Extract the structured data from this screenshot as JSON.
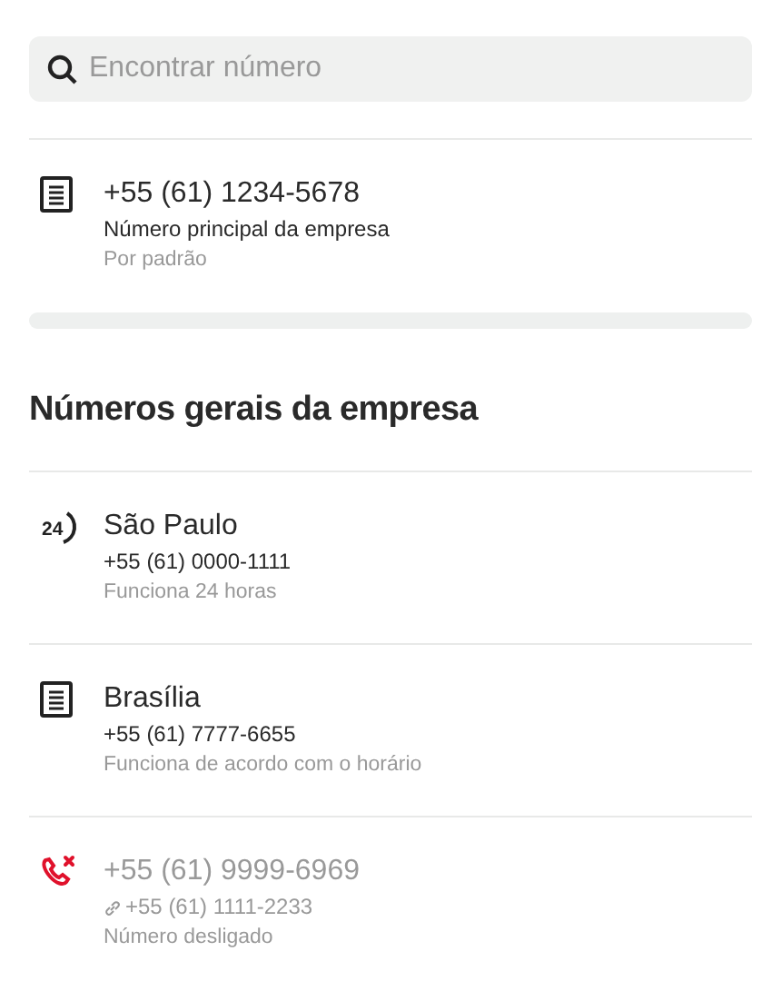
{
  "search": {
    "placeholder": "Encontrar número"
  },
  "main_number": {
    "kind": "document",
    "title": "+55 (61) 1234-5678",
    "line": "Número principal da empresa",
    "note": "Por padrão",
    "disabled": false,
    "linked": false
  },
  "section": {
    "title": "Números gerais da empresa"
  },
  "numbers": [
    {
      "kind": "clock24",
      "icon_text": "24",
      "title": "São Paulo",
      "line": "+55 (61) 0000-1111",
      "note": "Funciona 24 horas",
      "disabled": false,
      "linked": false
    },
    {
      "kind": "document",
      "title": "Brasília",
      "line": "+55 (61) 7777-6655",
      "note": "Funciona de acordo com o horário",
      "disabled": false,
      "linked": false
    },
    {
      "kind": "phone_off",
      "title": "+55 (61) 9999-6969",
      "line": "+55 (61) 1111-2233",
      "note": "Número desligado",
      "disabled": true,
      "linked": true
    }
  ]
}
